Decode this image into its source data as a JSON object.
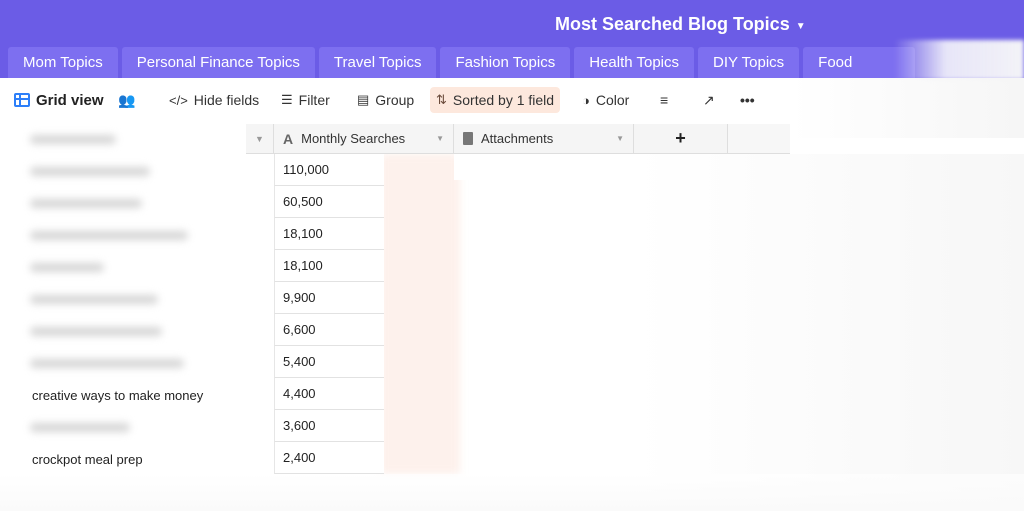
{
  "header": {
    "base_title": "Most Searched Blog Topics",
    "tabs": [
      "Mom Topics",
      "Personal Finance Topics",
      "Travel Topics",
      "Fashion Topics",
      "Health Topics",
      "DIY Topics",
      "Food"
    ],
    "accent_color": "#6b5ce6"
  },
  "toolbar": {
    "view_name": "Grid view",
    "hide_fields": "Hide fields",
    "filter": "Filter",
    "group": "Group",
    "sorted": "Sorted by 1 field",
    "color": "Color",
    "more": "•••"
  },
  "columns": {
    "monthly_searches": "Monthly Searches",
    "attachments": "Attachments",
    "add": "+"
  },
  "visible_topics": {
    "row8": "creative ways to make money",
    "row10": "crockpot meal prep"
  },
  "monthly_searches": [
    "110,000",
    "60,500",
    "18,100",
    "18,100",
    "9,900",
    "6,600",
    "5,400",
    "4,400",
    "3,600",
    "2,400"
  ]
}
